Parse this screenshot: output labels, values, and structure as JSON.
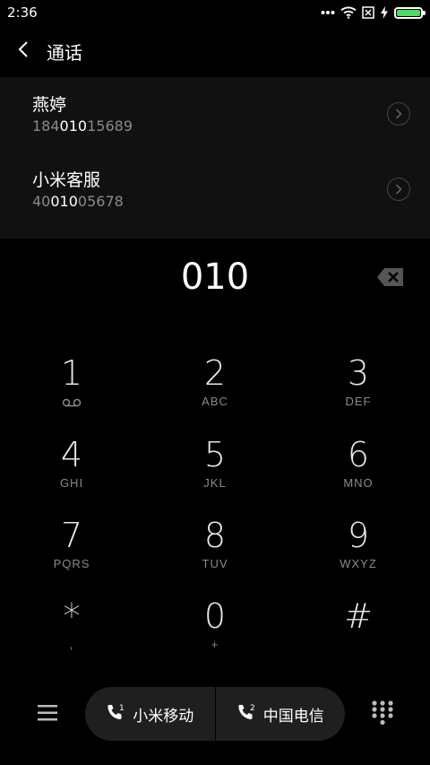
{
  "status_bar": {
    "time": "2:36",
    "battery_level": 1.0
  },
  "header": {
    "title": "通话"
  },
  "results": [
    {
      "name": "燕婷",
      "number_pre": "184",
      "number_match": "010",
      "number_post": "15689"
    },
    {
      "name": "小米客服",
      "number_pre": "40",
      "number_match": "010",
      "number_post": "05678"
    }
  ],
  "dial": {
    "number": "010"
  },
  "keypad": [
    {
      "digit": "1",
      "letters": ""
    },
    {
      "digit": "2",
      "letters": "ABC"
    },
    {
      "digit": "3",
      "letters": "DEF"
    },
    {
      "digit": "4",
      "letters": "GHI"
    },
    {
      "digit": "5",
      "letters": "JKL"
    },
    {
      "digit": "6",
      "letters": "MNO"
    },
    {
      "digit": "7",
      "letters": "PQRS"
    },
    {
      "digit": "8",
      "letters": "TUV"
    },
    {
      "digit": "9",
      "letters": "WXYZ"
    },
    {
      "digit": "*",
      "letters": ","
    },
    {
      "digit": "0",
      "letters": "+"
    },
    {
      "digit": "#",
      "letters": ""
    }
  ],
  "sim": {
    "sim1_label": "小米移动",
    "sim1_index": "1",
    "sim2_label": "中国电信",
    "sim2_index": "2"
  },
  "icons": {
    "battery": "battery-icon",
    "wifi": "wifi-icon",
    "more": "more-icon",
    "no-sim": "no-sim-icon",
    "charging": "charging-icon"
  },
  "colors": {
    "battery_fill": "#4cd964",
    "background": "#000000",
    "results_bg": "#111111",
    "secondary_text": "#8a8a8a"
  }
}
